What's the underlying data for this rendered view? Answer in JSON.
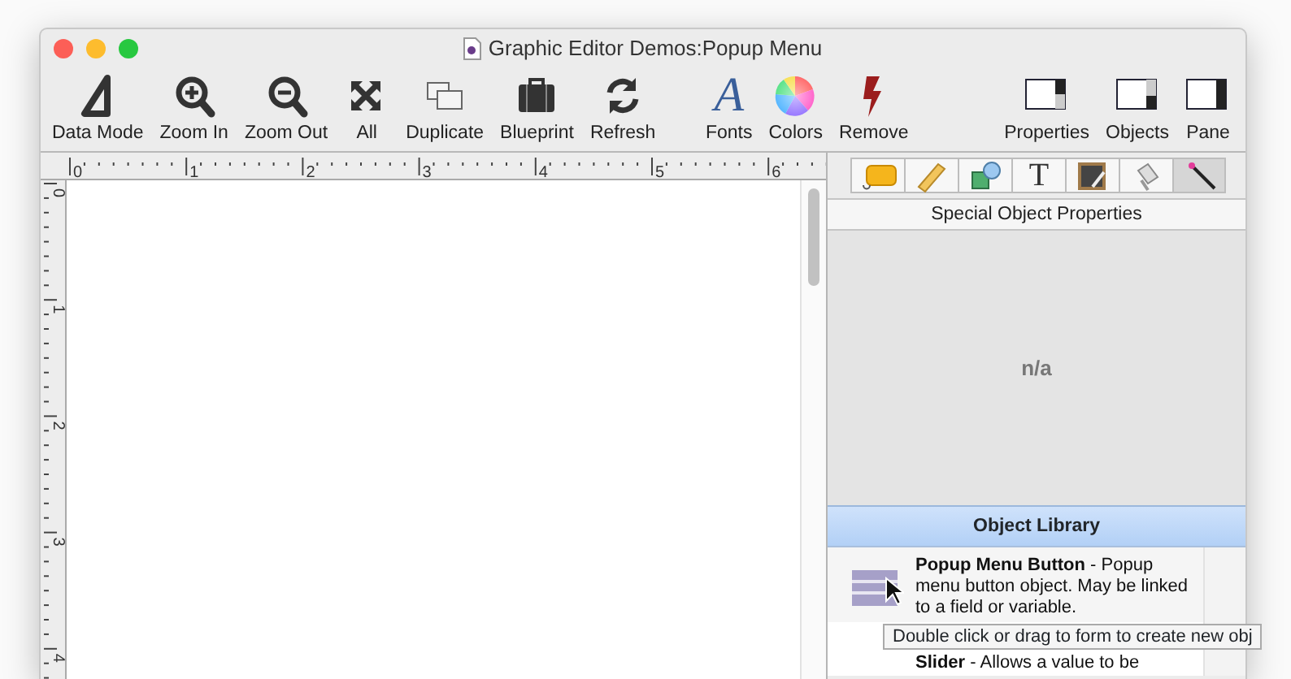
{
  "window": {
    "title": "Graphic Editor Demos:Popup Menu"
  },
  "toolbar": {
    "left": [
      {
        "label": "Data Mode",
        "kind": "triangle"
      },
      {
        "label": "Zoom In",
        "kind": "zoom-in"
      },
      {
        "label": "Zoom Out",
        "kind": "zoom-out"
      },
      {
        "label": "All",
        "kind": "expand"
      },
      {
        "label": "Duplicate",
        "kind": "duplicate"
      },
      {
        "label": "Blueprint",
        "kind": "briefcase"
      },
      {
        "label": "Refresh",
        "kind": "refresh"
      }
    ],
    "middle": [
      {
        "label": "Fonts",
        "kind": "glyph",
        "glyph": "A"
      },
      {
        "label": "Colors",
        "kind": "wheel"
      },
      {
        "label": "Remove",
        "kind": "bolt"
      }
    ],
    "right": [
      {
        "label": "Properties",
        "kind": "panel-a"
      },
      {
        "label": "Objects",
        "kind": "panel-b"
      },
      {
        "label": "Pane",
        "kind": "panel-c"
      }
    ]
  },
  "ruler": {
    "horizontal": [
      "0",
      "1",
      "2",
      "3",
      "4",
      "5",
      "6"
    ],
    "vertical": [
      "0",
      "1",
      "2",
      "3",
      "4"
    ]
  },
  "palette_tabs": [
    {
      "kind": "tag",
      "selected": false
    },
    {
      "kind": "ruler",
      "selected": false
    },
    {
      "kind": "shapes",
      "selected": false
    },
    {
      "kind": "glyph",
      "glyph": "T",
      "selected": false
    },
    {
      "kind": "board",
      "selected": false
    },
    {
      "kind": "eraser",
      "selected": false
    },
    {
      "kind": "wand",
      "selected": true
    }
  ],
  "properties": {
    "title": "Special Object Properties",
    "value": "n/a"
  },
  "object_library": {
    "title": "Object Library",
    "items": [
      {
        "text": "**Popup Menu Button** - Popup menu button object. May be linked to a field or variable.",
        "kind": "list",
        "selected": true
      },
      {
        "text": "**Slider** - Allows a value to be",
        "kind": "none",
        "selected": false
      }
    ]
  },
  "tooltip": "Double click or drag to form to create new obj"
}
